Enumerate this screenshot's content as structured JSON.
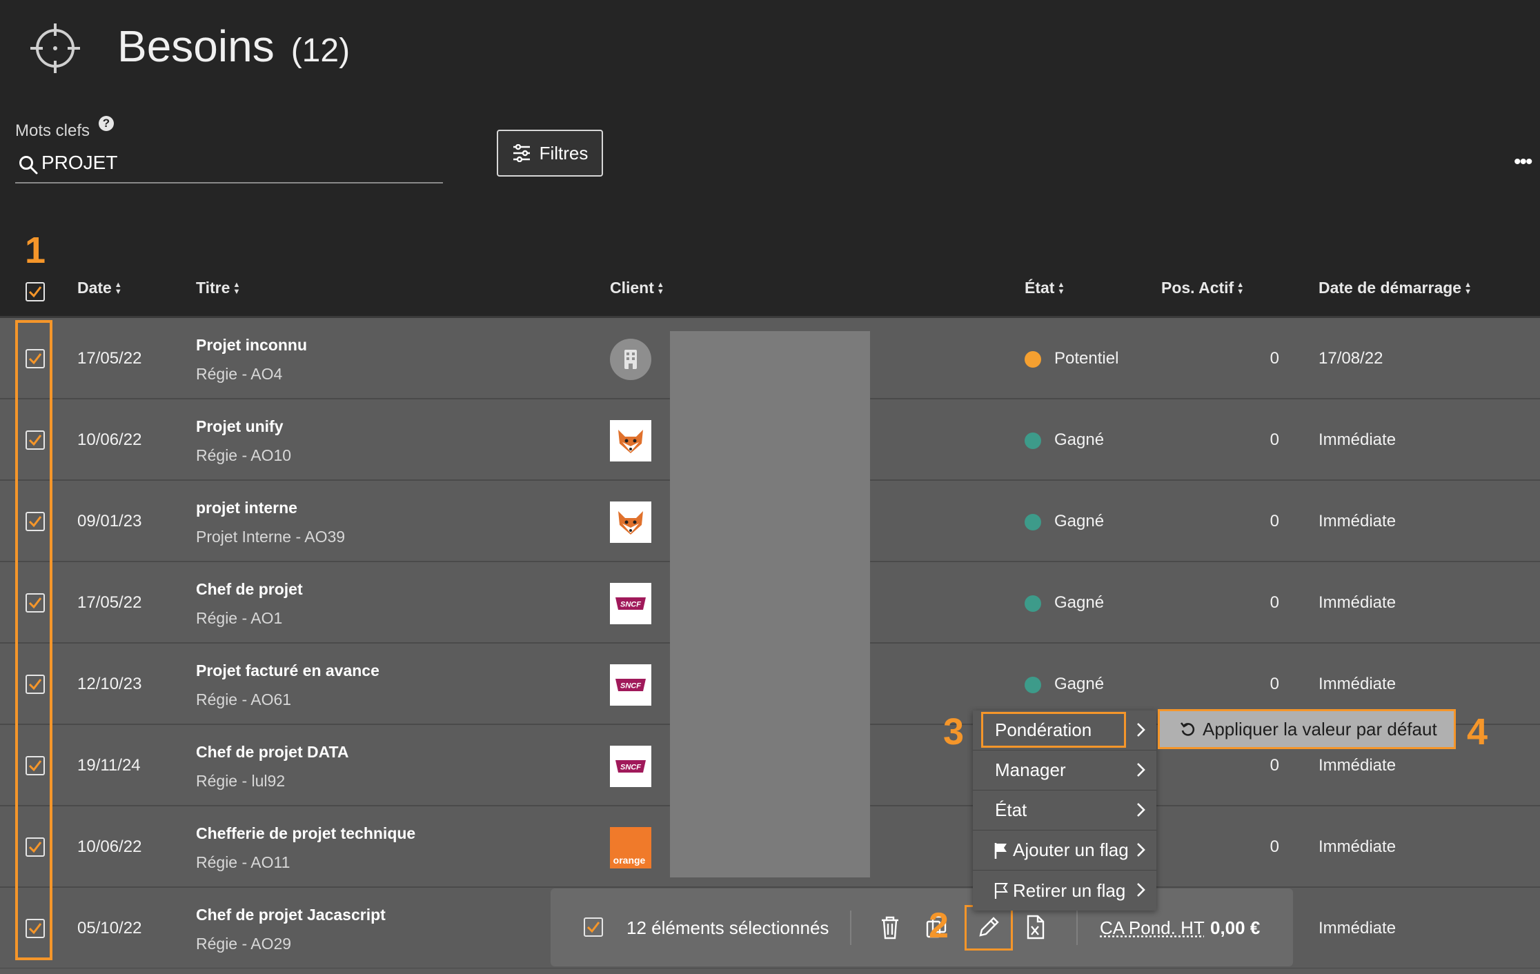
{
  "header": {
    "title": "Besoins",
    "count": "(12)"
  },
  "search": {
    "label": "Mots clefs",
    "help": "?",
    "value": "PROJET"
  },
  "toolbar": {
    "filters_label": "Filtres",
    "more_label": "•••"
  },
  "annotations": {
    "a1": "1",
    "a2": "2",
    "a3": "3",
    "a4": "4"
  },
  "table": {
    "columns": [
      "Date",
      "Titre",
      "Client",
      "État",
      "Pos. Actif",
      "Date de démarrage"
    ],
    "rows": [
      {
        "date": "17/05/22",
        "title": "Projet inconnu",
        "subtitle": "Régie - AO4",
        "logo": "building-icon",
        "etat": "Potentiel",
        "status_color": "#f5a030",
        "pos": "0",
        "start": "17/08/22"
      },
      {
        "date": "10/06/22",
        "title": "Projet unify",
        "subtitle": "Régie - AO10",
        "logo": "fox-logo",
        "etat": "Gagné",
        "status_color": "#3d9b8a",
        "pos": "0",
        "start": "Immédiate"
      },
      {
        "date": "09/01/23",
        "title": "projet interne",
        "subtitle": "Projet Interne - AO39",
        "logo": "fox-logo",
        "etat": "Gagné",
        "status_color": "#3d9b8a",
        "pos": "0",
        "start": "Immédiate"
      },
      {
        "date": "17/05/22",
        "title": "Chef de projet",
        "subtitle": "Régie - AO1",
        "logo": "sncf-logo",
        "logo_text": "SNCF",
        "etat": "Gagné",
        "status_color": "#3d9b8a",
        "pos": "0",
        "start": "Immédiate"
      },
      {
        "date": "12/10/23",
        "title": "Projet facturé en avance",
        "subtitle": "Régie - AO61",
        "logo": "sncf-logo",
        "logo_text": "SNCF",
        "etat": "Gagné",
        "status_color": "#3d9b8a",
        "pos": "0",
        "start": "Immédiate"
      },
      {
        "date": "19/11/24",
        "title": "Chef de projet DATA",
        "subtitle": "Régie - lul92",
        "logo": "sncf-logo",
        "logo_text": "SNCF",
        "etat": "",
        "status_color": "",
        "pos": "0",
        "start": "Immédiate"
      },
      {
        "date": "10/06/22",
        "title": "Chefferie de projet technique",
        "subtitle": "Régie - AO11",
        "logo": "orange-logo",
        "logo_text": "orange",
        "etat": "",
        "status_color": "",
        "pos": "0",
        "start": "Immédiate"
      },
      {
        "date": "05/10/22",
        "title": "Chef de projet Jacascript",
        "subtitle": "Régie - AO29",
        "logo": "",
        "etat": "",
        "status_color": "",
        "pos": "",
        "start": "Immédiate"
      }
    ]
  },
  "selection_bar": {
    "count_label": "12 éléments sélectionnés",
    "ca_label": "CA Pond. HT",
    "ca_value": "0,00 €"
  },
  "context_menu": {
    "items": [
      "Pondération",
      "Manager",
      "État",
      "Ajouter un flag",
      "Retirer un flag"
    ],
    "submenu_label": "Appliquer la valeur par défaut"
  },
  "colors": {
    "accent": "#f5962a",
    "potentiel": "#f5a030",
    "gagne": "#3d9b8a",
    "sncf": "#a0195a",
    "orange_brand": "#f07a2a"
  }
}
